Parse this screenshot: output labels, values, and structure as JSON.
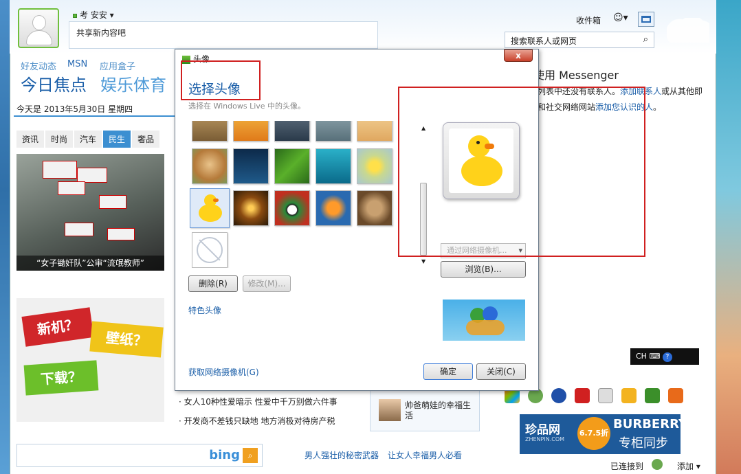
{
  "profile": {
    "name": "考 安安",
    "share_placeholder": "共享新内容吧"
  },
  "header": {
    "inbox": "收件箱",
    "search_placeholder": "搜索联系人或网页"
  },
  "nav": {
    "tab1": "好友动态",
    "tab2": "MSN",
    "tab3": "应用盒子",
    "headline1": "今日焦点",
    "headline2": "娱乐体育"
  },
  "date_line": "今天是 2013年5月30日 星期四",
  "categories": [
    "资讯",
    "时尚",
    "汽车",
    "民生",
    "奢品"
  ],
  "photo_caption": "“女子锄奸队”公审“流氓教师”",
  "ad_tags": {
    "a": "新机？",
    "b": "壁纸？",
    "c": "下载？"
  },
  "news_items": [
    "女人10种性爱暗示 性爱中千万别做六件事",
    "开发商不差钱只缺地 地方消极对待房产税"
  ],
  "side_news": "帅爸萌娃的幸福生活",
  "bottom_links": {
    "a": "男人强壮的秘密武器",
    "b": "让女人幸福男人必看"
  },
  "bing_label": "bing",
  "messenger": {
    "title": "使用 Messenger",
    "line1a": "列表中还没有联系人。",
    "line1b": "添加联系人",
    "line1c": "或从其他即",
    "line2a": "和社交网络网站",
    "line2b": "添加您认识的人",
    "line2c": "。"
  },
  "dialog": {
    "window_title": "头像",
    "heading": "选择头像",
    "subheading": "选择在 Windows Live 中的头像。",
    "delete": "删除(R)",
    "modify": "修改(M)...",
    "special": "特色头像",
    "webcam_select": "通过网络摄像机...",
    "browse": "浏览(B)...",
    "get_webcam": "获取网络摄像机(G)",
    "ok": "确定",
    "close": "关闭(C)"
  },
  "taskbar": {
    "lang": "CH",
    "connected": "已连接到",
    "add": "添加"
  },
  "banner": {
    "site": "珍品网",
    "site_en": "ZHENPIN.COM",
    "discount": "6.7.5折",
    "brand": "BURBERRY",
    "slogan": "专柜同步"
  }
}
